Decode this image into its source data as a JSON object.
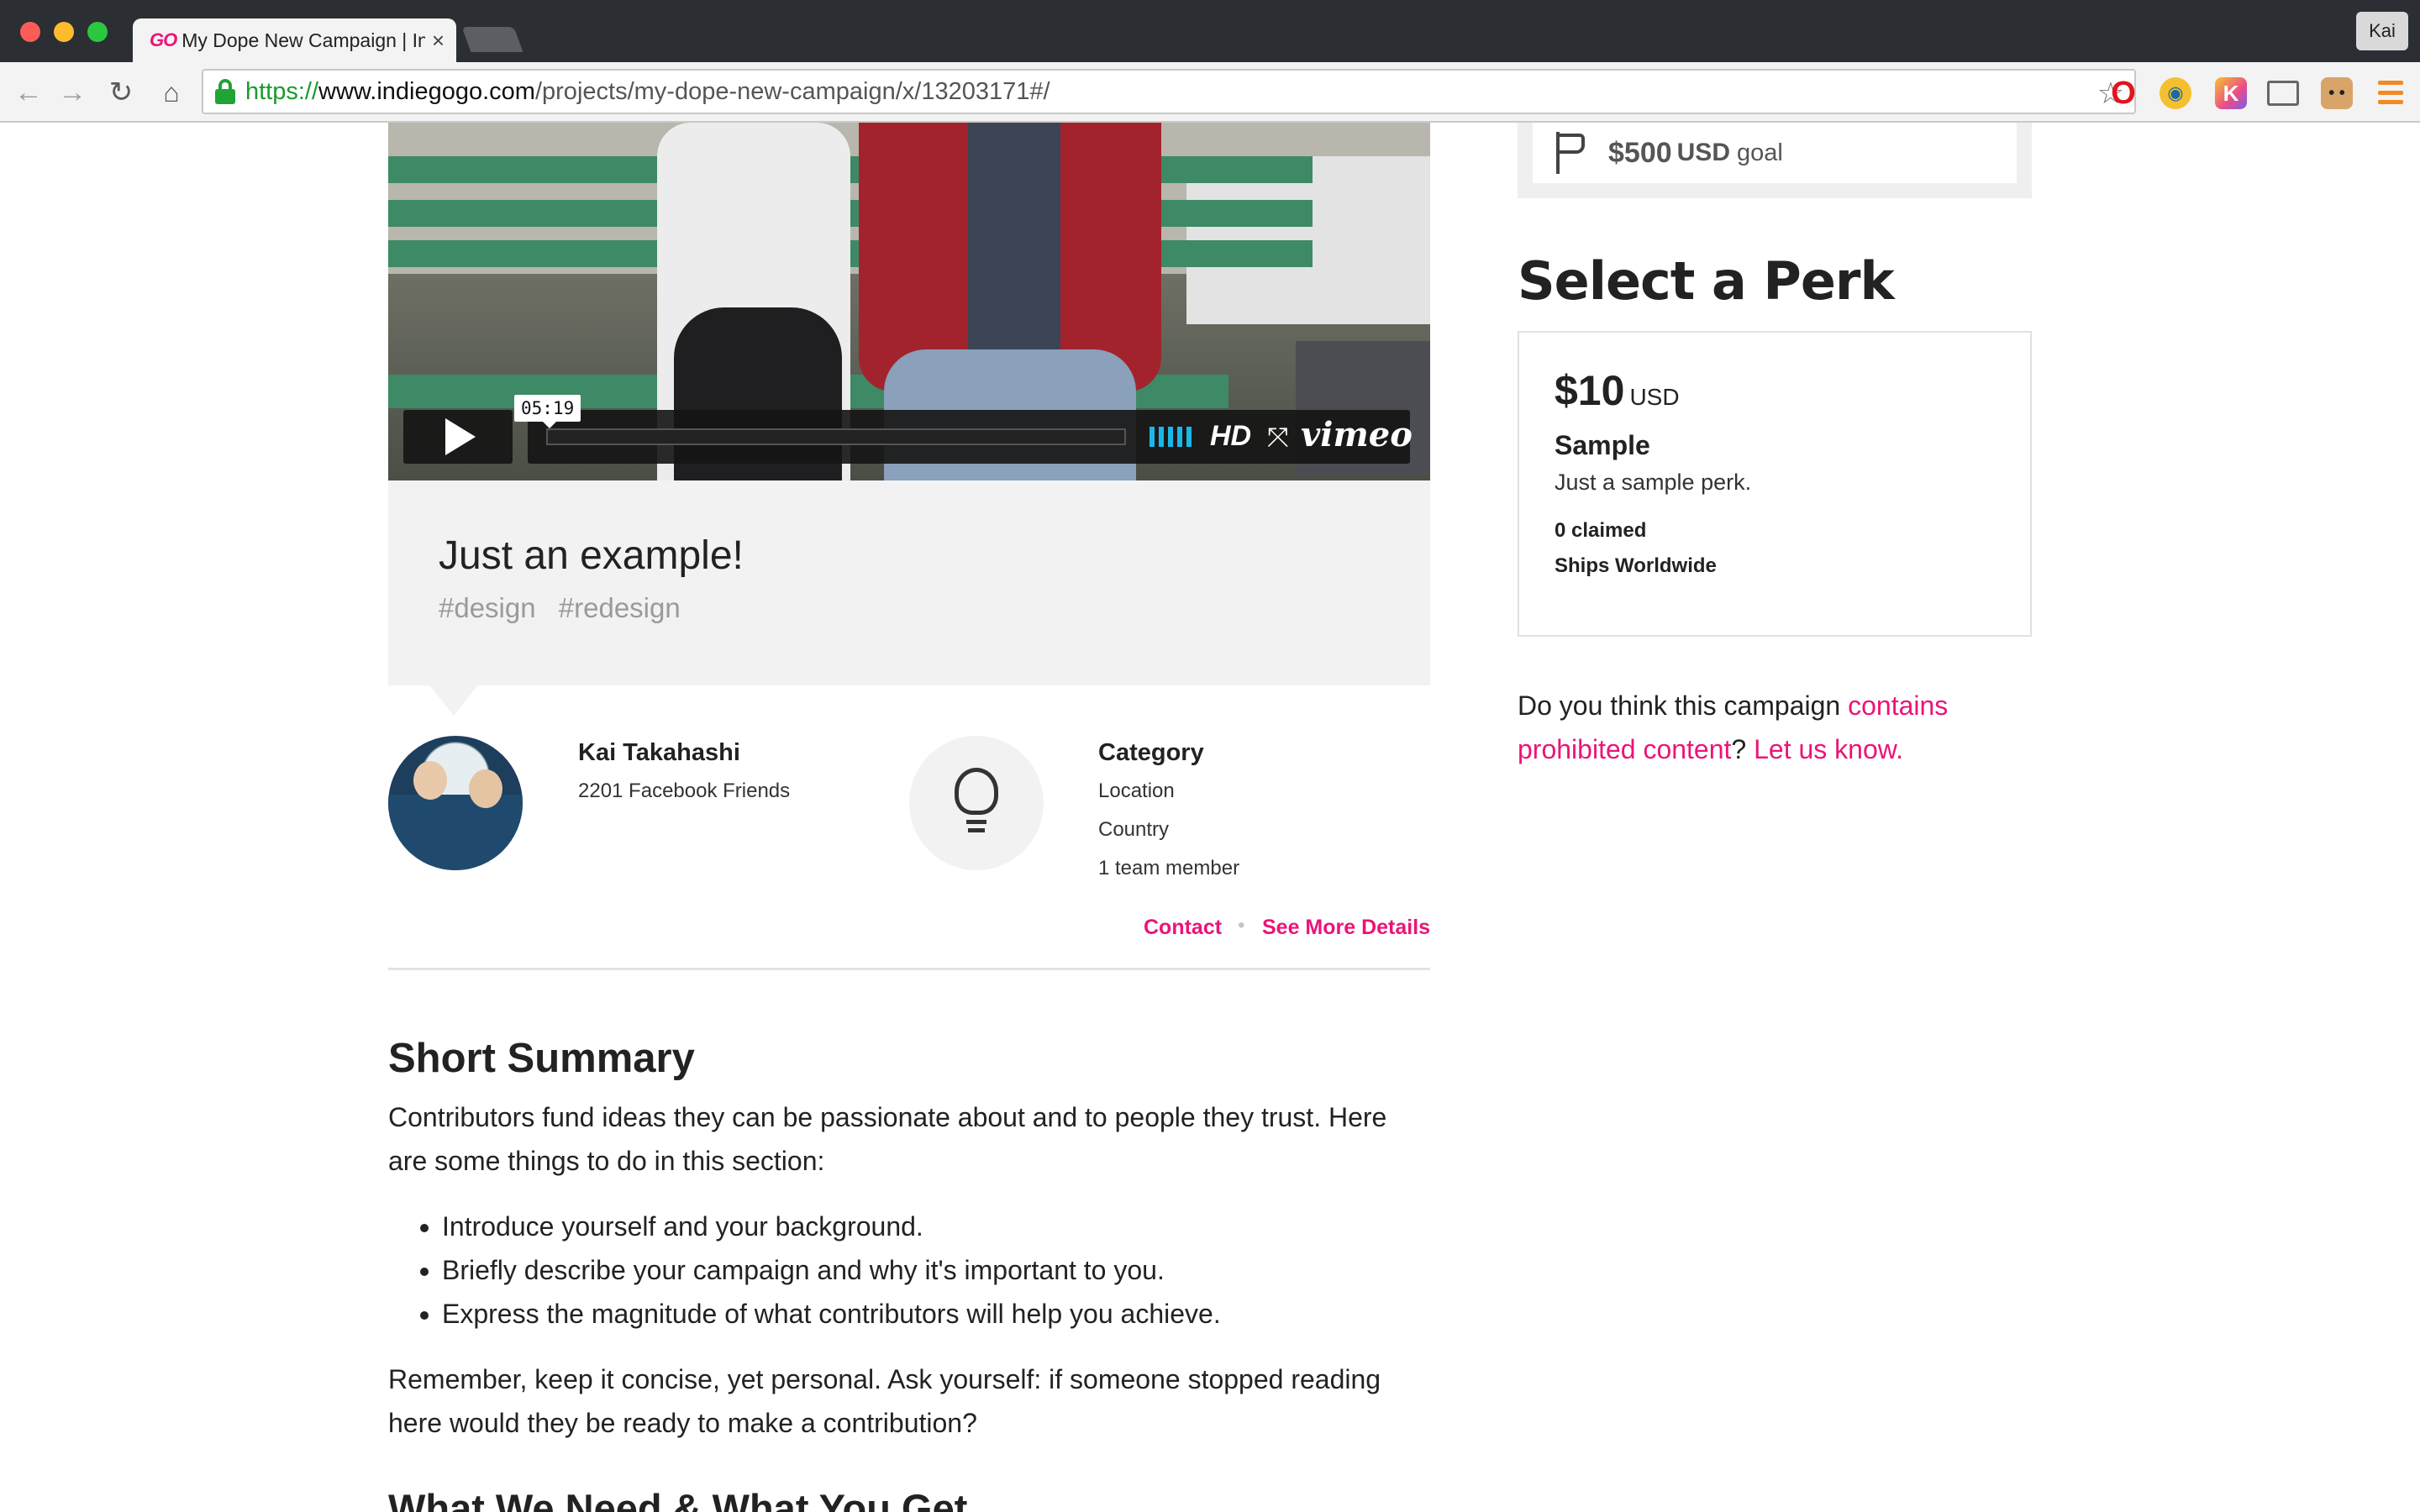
{
  "browser": {
    "tab_favicon": "GO",
    "tab_title": "My Dope New Campaign | Indiegogo",
    "tab_close": "×",
    "profile_name": "Kai",
    "url_proto": "https://",
    "url_host": "www.indiegogo.com",
    "url_path": "/projects/my-dope-new-campaign/x/13203171#/",
    "icons": {
      "back": "←",
      "forward": "→",
      "reload": "↻",
      "home": "⌂",
      "star": "☆",
      "opera": "O",
      "fish": "◉",
      "kolor": "K",
      "face": "• •"
    }
  },
  "video": {
    "timestamp": "05:19",
    "hd_label": "HD",
    "fullscreen_icon": "⤧",
    "brand": "vimeo"
  },
  "campaign": {
    "title": "Just an example!",
    "tags": [
      "#design",
      "#redesign"
    ]
  },
  "owner": {
    "name": "Kai Takahashi",
    "friends": "2201 Facebook Friends"
  },
  "category": {
    "title": "Category",
    "location": "Location",
    "country": "Country",
    "team": "1 team member"
  },
  "links": {
    "contact": "Contact",
    "separator": "•",
    "details": "See More Details"
  },
  "summary": {
    "title": "Short Summary",
    "intro": "Contributors fund ideas they can be passionate about and to people they trust. Here are some things to do in this section:",
    "bullets": [
      "Introduce yourself and your background.",
      "Briefly describe your campaign and why it's important to you.",
      "Express the magnitude of what contributors will help you achieve."
    ],
    "closing": "Remember, keep it concise, yet personal. Ask yourself: if someone stopped reading here would they be ready to make a contribution?",
    "next_heading": "What We Need & What You Get"
  },
  "goal": {
    "amount": "$500",
    "currency": "USD",
    "label": "goal"
  },
  "perks": {
    "heading": "Select a Perk",
    "items": [
      {
        "price": "$10",
        "currency": "USD",
        "name": "Sample",
        "description": "Just a sample perk.",
        "claimed": "0 claimed",
        "shipping": "Ships Worldwide"
      }
    ]
  },
  "report": {
    "prefix": "Do you think this campaign ",
    "link1": "contains prohibited content",
    "middle": "? ",
    "link2": "Let us know."
  },
  "colors": {
    "accent": "#eb1478",
    "chrome_dark": "#2b2e33",
    "panel_gray": "#f2f2f2",
    "vimeo_blue": "#1ab7ea"
  }
}
